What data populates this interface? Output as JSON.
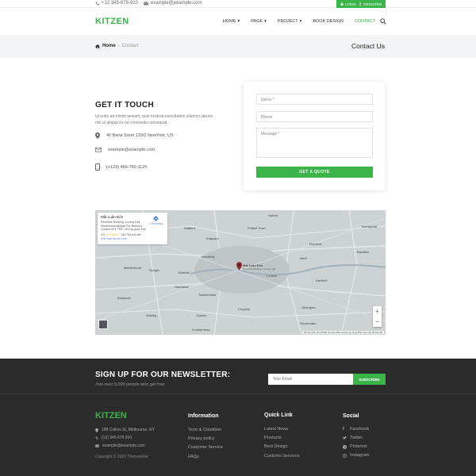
{
  "topbar": {
    "phone": "+12 345-678-910",
    "email": "example@example.com",
    "login": "LOGIN",
    "register": "REGISTER"
  },
  "header": {
    "logo": "KITZEN",
    "nav": [
      {
        "label": "HOME",
        "caret": true
      },
      {
        "label": "PAGE",
        "caret": true
      },
      {
        "label": "PROJECT",
        "caret": true
      },
      {
        "label": "BOOK DESIGN",
        "caret": false
      },
      {
        "label": "CONTACT",
        "caret": false,
        "active": true
      }
    ]
  },
  "breadcrumb": {
    "home": "Home",
    "current": "Contact",
    "title": "Contact Us"
  },
  "contact": {
    "title": "GET IT TOUCH",
    "description": "Ut enim ad minim veniam, quis nostrud exercitation ullamco laboris nisi ut aliquip ex ea commodo consequat.",
    "address": "40 Baria Sreet 133/2 NewYork, US",
    "email": "example@example.com",
    "phone": "(+123) 456-789-1120"
  },
  "form": {
    "name_placeholder": "Name *",
    "phone_placeholder": "Phone",
    "message_placeholder": "Message *",
    "submit_label": "GET A QUOTE"
  },
  "map": {
    "card_title": "Mất Luân Đôn",
    "card_address": "Riverside Building, County Hall, Westminster Bridge Rd, Bishop's, London SE1 7PB, Vương quốc Anh",
    "directions": "Chỉ đường",
    "rating": "4.5",
    "reviews": "133.734 bài viết",
    "larger_map": "Xem bản đồ lớn hơn",
    "pin_label": "Mất Luân Đôn",
    "pin_sub": "Riverside Building, County Hall",
    "places": [
      "Harlow",
      "Chesham",
      "Enfield Town",
      "Watford",
      "Edgware",
      "Romford",
      "Basildon",
      "Maidenhead",
      "Slough",
      "Southall",
      "London",
      "Hounslow",
      "Twickenham",
      "Dartford",
      "Bracknell",
      "Croydon",
      "Woking",
      "Epsom",
      "Leatherhead",
      "Orpington",
      "Sevenoaks",
      "Brentwood",
      "Wembley",
      "Ilford"
    ],
    "attribution": "Dữ liệu bản đồ ©2020 Google  Điều khoản sử dụng  Báo cáo một lỗi bản đồ"
  },
  "newsletter": {
    "title": "SIGN UP FOR OUR NEWSLETTER:",
    "subtitle": "Join over 5,000 people who get free",
    "input_placeholder": "Your Email",
    "button_label": "SUBSCRIBE"
  },
  "footer": {
    "logo": "KITZEN",
    "address": "198 Collins St, Melbourne, NY",
    "phone": "(12) 345 678 910",
    "email": "example@example.com",
    "copyright": "Copyright © 2020 ThemesFlat",
    "information_title": "Information",
    "information_links": [
      "Term & Condition",
      "Privacy policy",
      "Customer Service",
      "FAQs"
    ],
    "quicklink_title": "Quick Link",
    "quicklink_links": [
      "Latest News",
      "Products",
      "Best Design",
      "Customs Services"
    ],
    "social_title": "Social",
    "social_links": [
      "Facebook",
      "Twitter",
      "Pinterest",
      "Instagram"
    ]
  },
  "colors": {
    "accent": "#3bb54a",
    "footer_bg": "#2b2b2b",
    "crumb_bg": "#f3f4f6"
  }
}
